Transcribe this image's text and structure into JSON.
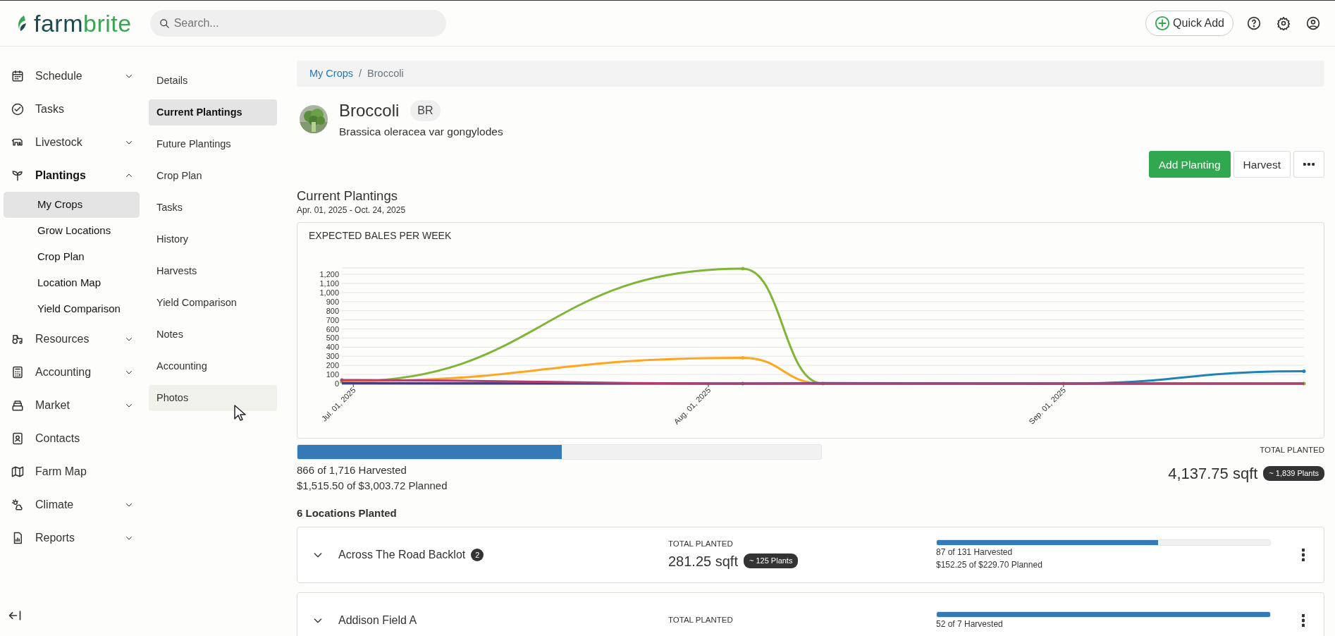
{
  "app": {
    "logo_part_1": "farm",
    "logo_part_2": "brite"
  },
  "search": {
    "placeholder": "Search..."
  },
  "top_actions": {
    "quick_add": "Quick Add"
  },
  "sidebar": {
    "items": [
      {
        "label": "Schedule",
        "kind": "group",
        "expanded": false
      },
      {
        "label": "Tasks",
        "kind": "link"
      },
      {
        "label": "Livestock",
        "kind": "group",
        "expanded": false
      },
      {
        "label": "Plantings",
        "kind": "group",
        "expanded": true,
        "children": [
          {
            "label": "My Crops",
            "selected": true
          },
          {
            "label": "Grow Locations",
            "selected": false
          },
          {
            "label": "Crop Plan",
            "selected": false
          },
          {
            "label": "Location Map",
            "selected": false
          },
          {
            "label": "Yield Comparison",
            "selected": false
          }
        ]
      },
      {
        "label": "Resources",
        "kind": "group",
        "expanded": false
      },
      {
        "label": "Accounting",
        "kind": "group",
        "expanded": false
      },
      {
        "label": "Market",
        "kind": "group",
        "expanded": false
      },
      {
        "label": "Contacts",
        "kind": "link"
      },
      {
        "label": "Farm Map",
        "kind": "link"
      },
      {
        "label": "Climate",
        "kind": "group",
        "expanded": false
      },
      {
        "label": "Reports",
        "kind": "group",
        "expanded": false
      }
    ]
  },
  "crop_nav": {
    "items": [
      {
        "label": "Details",
        "selected": false,
        "hovered": false
      },
      {
        "label": "Current Plantings",
        "selected": true,
        "hovered": false
      },
      {
        "label": "Future Plantings",
        "selected": false,
        "hovered": false
      },
      {
        "label": "Crop Plan",
        "selected": false,
        "hovered": false
      },
      {
        "label": "Tasks",
        "selected": false,
        "hovered": false
      },
      {
        "label": "History",
        "selected": false,
        "hovered": false
      },
      {
        "label": "Harvests",
        "selected": false,
        "hovered": false
      },
      {
        "label": "Yield Comparison",
        "selected": false,
        "hovered": false
      },
      {
        "label": "Notes",
        "selected": false,
        "hovered": false
      },
      {
        "label": "Accounting",
        "selected": false,
        "hovered": false
      },
      {
        "label": "Photos",
        "selected": false,
        "hovered": true
      }
    ]
  },
  "breadcrumb": {
    "separator": "/",
    "items": [
      {
        "label": "My Crops",
        "kind": "link"
      },
      {
        "label": "Broccoli",
        "kind": "current"
      }
    ]
  },
  "crop": {
    "name": "Broccoli",
    "code": "BR",
    "scientific_name": "Brassica oleracea var gongylodes"
  },
  "actions": [
    {
      "label": "Add Planting",
      "kind": "primary"
    },
    {
      "label": "Harvest",
      "kind": "secondary"
    },
    {
      "kind": "more"
    }
  ],
  "section": {
    "title": "Current Plantings",
    "date_range": "Apr. 01, 2025 - Oct. 24, 2025"
  },
  "chart": {
    "title": "EXPECTED BALES PER WEEK",
    "chart_data": {
      "type": "line",
      "x": [
        "2025-06-30",
        "2025-08-04",
        "2025-08-11",
        "2025-09-01",
        "2025-09-22"
      ],
      "xlim": [
        "2025-06-30",
        "2025-09-22"
      ],
      "ylim": [
        0,
        1270
      ],
      "grid": true,
      "xticks": [
        {
          "value": "2025-07-01",
          "label": "Jul. 01, 2025"
        },
        {
          "value": "2025-08-01",
          "label": "Aug. 01, 2025"
        },
        {
          "value": "2025-09-01",
          "label": "Sep. 01, 2025"
        }
      ],
      "yticks": [
        0,
        100,
        200,
        300,
        400,
        500,
        600,
        700,
        800,
        900,
        {
          "value": 1000,
          "label": "1,000"
        },
        {
          "value": 1100,
          "label": "1,100"
        },
        {
          "value": 1200,
          "label": "1,200"
        }
      ],
      "series": [
        {
          "color": "#80b536",
          "values": [
            20,
            1262,
            0,
            0,
            0
          ]
        },
        {
          "color": "#ffa51e",
          "values": [
            25,
            283,
            0,
            null,
            null
          ]
        },
        {
          "color": "#1f84b5",
          "values": [
            0,
            0,
            5,
            0,
            135
          ]
        },
        {
          "color": "#4a3a7a",
          "values": [
            5,
            0,
            0,
            0,
            0
          ]
        },
        {
          "color": "#b33f6e",
          "values": [
            38,
            0,
            0,
            0,
            0
          ]
        }
      ]
    }
  },
  "summary": {
    "level": 0.505,
    "harvested": "866 of 1,716 Harvested",
    "planned": "$1,515.50 of $3,003.72 Planned",
    "total_label": "TOTAL PLANTED",
    "total": "4,137.75 sqft",
    "plants": "~ 1,839 Plants"
  },
  "locations": {
    "heading": "6 Locations Planted",
    "rows": [
      {
        "name": "Across The Road Backlot",
        "count": "2",
        "total_label": "TOTAL PLANTED",
        "total": "281.25 sqft",
        "plants": "~ 125 Plants",
        "level": 0.664,
        "harvested": "87 of 131 Harvested",
        "planned": "$152.25 of $229.70 Planned"
      },
      {
        "name": "Addison Field A",
        "total_label": "TOTAL PLANTED",
        "level": 1.0,
        "harvested": "52 of 7 Harvested"
      }
    ]
  }
}
